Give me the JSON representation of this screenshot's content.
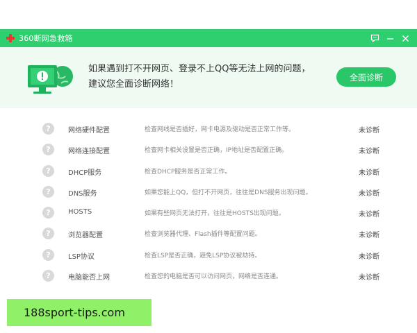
{
  "window": {
    "title": "360断网急救箱",
    "controls": {
      "feedback": "🗨",
      "minimize": "—",
      "close": "✕"
    }
  },
  "banner": {
    "line1": "如果遇到打不开网页、登录不上QQ等无法上网的问题，",
    "line2": "建议您全面诊断网络！",
    "scan_button": "全面诊断"
  },
  "items": [
    {
      "name": "网络硬件配置",
      "desc": "检查网线是否插好，网卡电源及驱动是否正常工作等。",
      "status": "未诊断"
    },
    {
      "name": "网络连接配置",
      "desc": "检查网卡相关设置是否正确，IP地址是否配置正确。",
      "status": "未诊断"
    },
    {
      "name": "DHCP服务",
      "desc": "检查DHCP服务是否正常工作。",
      "status": "未诊断"
    },
    {
      "name": "DNS服务",
      "desc": "如果您能上QQ，但打不开网页，往往是DNS服务出现问题。",
      "status": "未诊断"
    },
    {
      "name": "HOSTS",
      "desc": "如果有些网页无法打开，往往是HOSTS出现问题。",
      "status": "未诊断"
    },
    {
      "name": "浏览器配置",
      "desc": "检查浏览器代理、Flash插件等配置问题。",
      "status": "未诊断"
    },
    {
      "name": "LSP协议",
      "desc": "检查LSP是否正确，避免LSP协议被劫持。",
      "status": "未诊断"
    },
    {
      "name": "电脑能否上网",
      "desc": "检查您的电脑是否可以访问网页，网络是否连通。",
      "status": "未诊断"
    }
  ],
  "question_mark": "?",
  "watermark": "188sport-tips.com",
  "colors": {
    "accent": "#2fcf6f",
    "button": "#29c768",
    "banner_bg": "#eefaf2",
    "icon_gray": "#d9d9d9"
  }
}
